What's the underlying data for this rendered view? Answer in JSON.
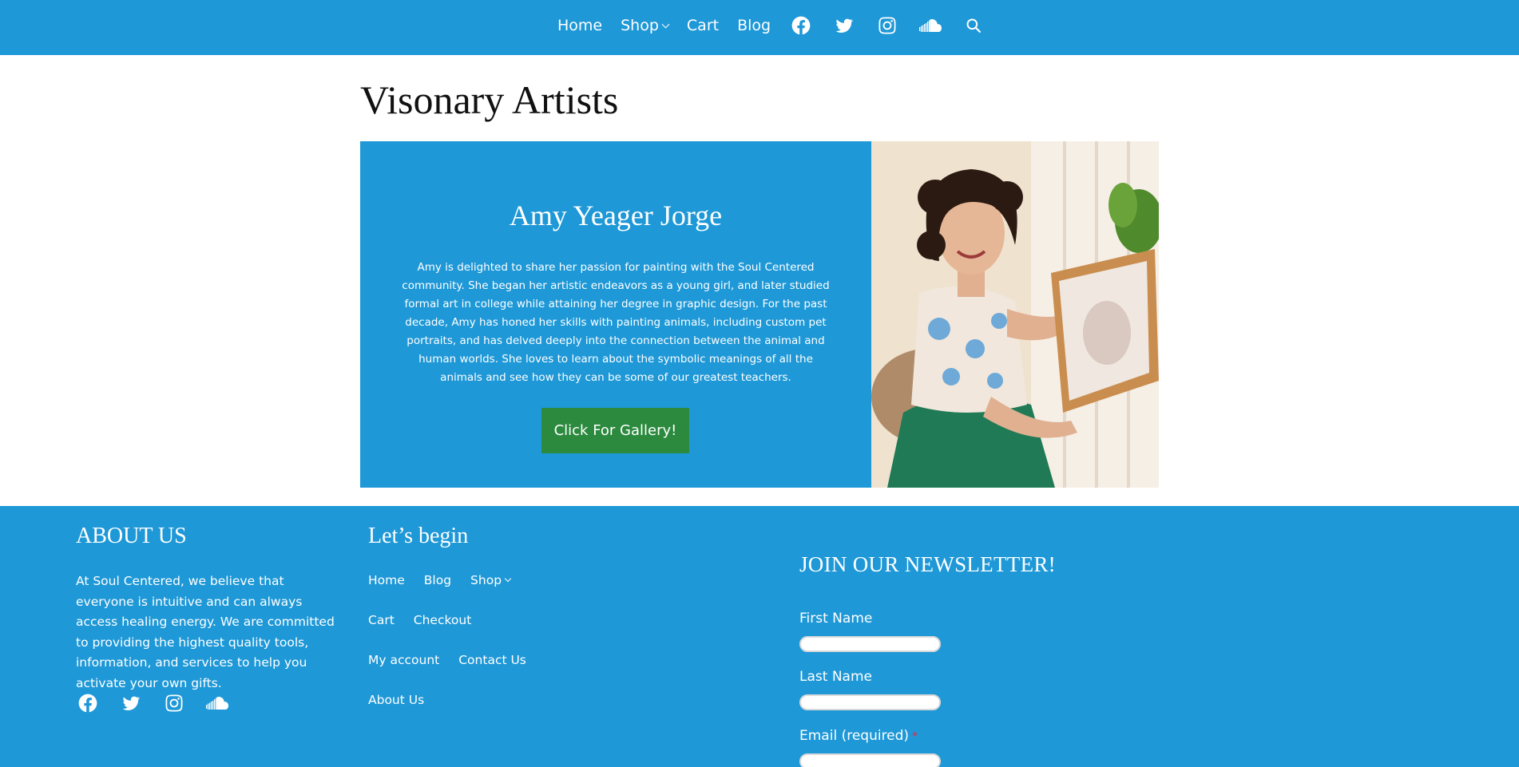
{
  "header": {
    "nav": [
      {
        "label": "Home"
      },
      {
        "label": "Shop"
      },
      {
        "label": "Cart"
      },
      {
        "label": "Blog"
      }
    ],
    "social_icons": [
      "facebook-icon",
      "twitter-icon",
      "instagram-icon",
      "soundcloud-icon"
    ],
    "search_icon": "search-icon"
  },
  "page": {
    "title": "Visonary Artists"
  },
  "hero": {
    "name": "Amy Yeager Jorge",
    "bio": "Amy is delighted to share her passion for painting with the Soul Centered community. She began her artistic endeavors as a young girl, and later studied formal art in college while attaining her degree in graphic design. For the past decade, Amy has honed her skills with painting animals, including custom pet portraits, and has delved deeply into the connection between the animal and human worlds. She loves to learn about the symbolic meanings of all the animals and see how they can be some of our greatest teachers.",
    "button": "Click For Gallery!"
  },
  "footer": {
    "about": {
      "heading": "ABOUT US",
      "text": "At Soul Centered, we believe that everyone is intuitive and can always access healing energy. We are committed to providing the highest quality tools, information, and services to help you activate your own gifts."
    },
    "links": {
      "heading": "Let’s begin",
      "rows": [
        [
          "Home",
          "Blog",
          "Shop"
        ],
        [
          "Cart",
          "Checkout"
        ],
        [
          "My account",
          "Contact Us"
        ],
        [
          "About Us"
        ]
      ]
    },
    "newsletter": {
      "heading": "JOIN OUR NEWSLETTER!",
      "first_name": "First Name",
      "last_name": "Last Name",
      "email": "Email (required)",
      "required_mark": "*"
    }
  },
  "colors": {
    "brand_blue": "#1e98d7",
    "button_green": "#2b8a3e",
    "required_red": "#e2294f"
  }
}
